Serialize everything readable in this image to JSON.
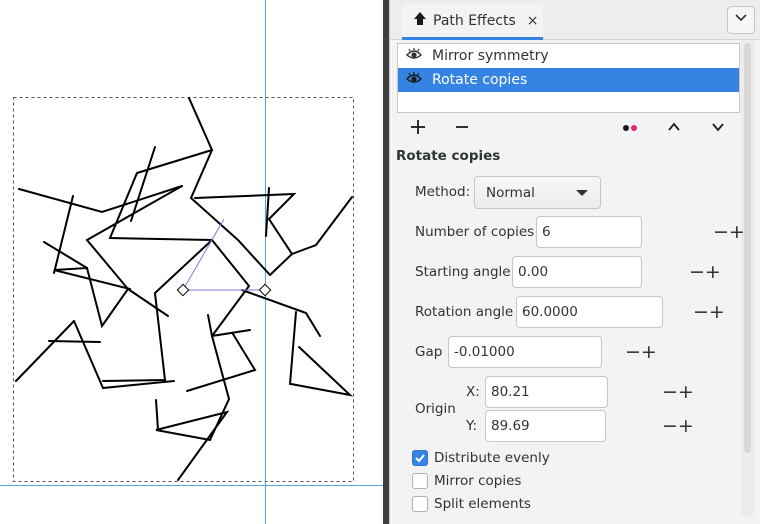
{
  "panel": {
    "tab_label": "Path Effects",
    "tab_close": "×"
  },
  "effects_list": {
    "items": [
      {
        "label": "Mirror symmetry",
        "selected": false,
        "icon": "eye-icon"
      },
      {
        "label": "Rotate copies",
        "selected": true,
        "icon": "eye-icon"
      }
    ]
  },
  "toolbar": {
    "add_label": "+",
    "remove_label": "−"
  },
  "effect": {
    "title": "Rotate copies",
    "method_label": "Method:",
    "method_value": "Normal",
    "copies_label": "Number of copies",
    "copies_value": "6",
    "start_label": "Starting angle",
    "start_value": "0.00",
    "rotation_label": "Rotation angle",
    "rotation_value": "60.0000",
    "gap_label": "Gap",
    "gap_value": "-0.01000",
    "origin_label": "Origin",
    "origin_x_label": "X:",
    "origin_x_value": "80.21",
    "origin_y_label": "Y:",
    "origin_y_value": "89.69",
    "distribute_label": "Distribute evenly",
    "distribute_checked": true,
    "mirror_label": "Mirror copies",
    "mirror_checked": false,
    "split_label": "Split elements",
    "split_checked": false
  },
  "colors": {
    "accent": "#3584e4",
    "guide": "#5aa5d8",
    "helper": "#7a7ae0"
  }
}
